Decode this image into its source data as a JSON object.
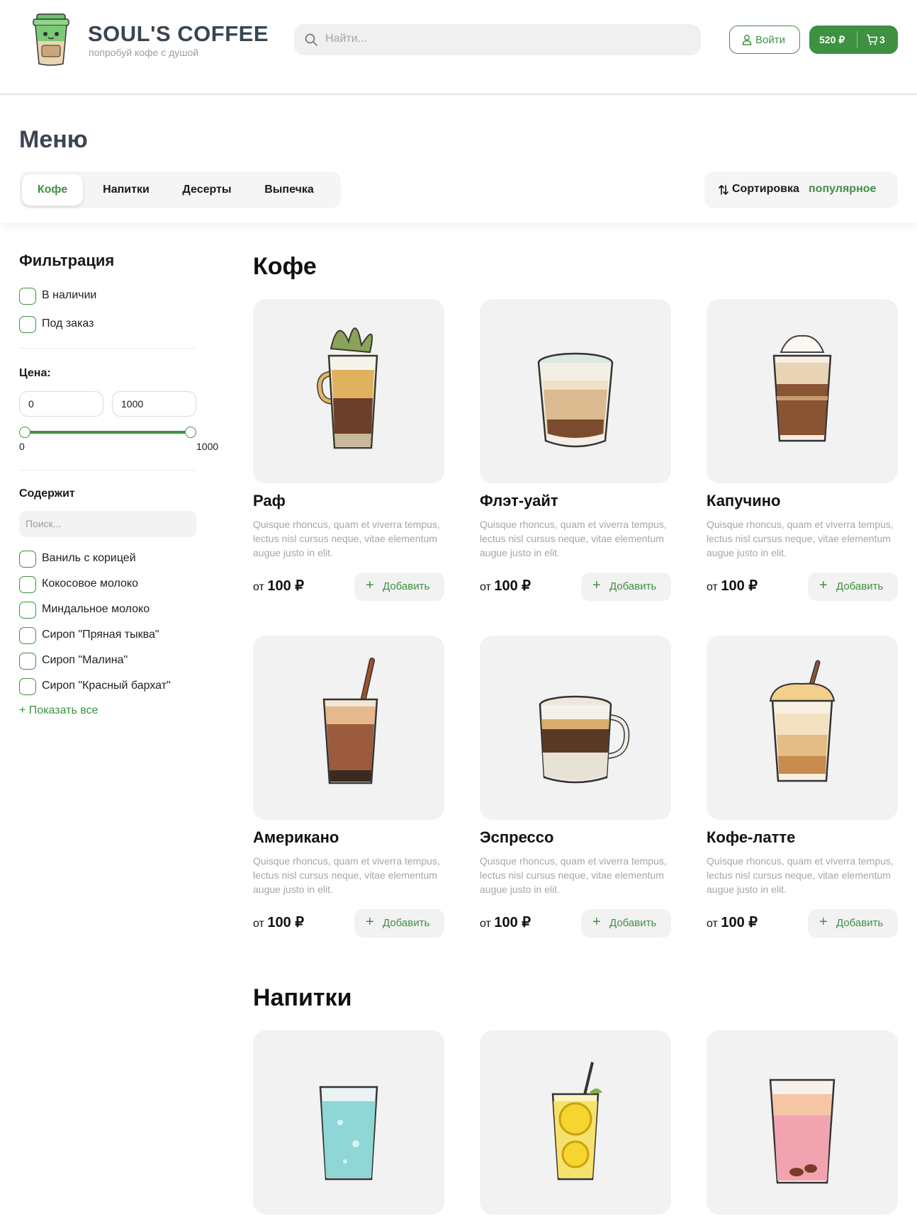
{
  "header": {
    "brand_name": "SOUL'S COFFEE",
    "brand_tagline": "попробуй кофе с душой",
    "search_placeholder": "Найти...",
    "login_label": "Войти",
    "cart_total": "520 ₽",
    "cart_count": "3"
  },
  "menu": {
    "title": "Меню",
    "tabs": [
      {
        "label": "Кофе",
        "active": true
      },
      {
        "label": "Напитки",
        "active": false
      },
      {
        "label": "Десерты",
        "active": false
      },
      {
        "label": "Выпечка",
        "active": false
      }
    ],
    "sort_label": "Сортировка",
    "sort_value": "популярное"
  },
  "filters": {
    "title": "Фильтрация",
    "availability": [
      {
        "label": "В наличии",
        "checked": false
      },
      {
        "label": "Под заказ",
        "checked": false
      }
    ],
    "price_title": "Цена:",
    "price_min": "0",
    "price_max": "1000",
    "slider_min_label": "0",
    "slider_max_label": "1000",
    "contains_title": "Содержит",
    "contains_search_placeholder": "Поиск...",
    "contains": [
      {
        "label": "Ваниль с корицей",
        "checked": false
      },
      {
        "label": "Кокосовое молоко",
        "checked": false
      },
      {
        "label": "Миндальное молоко",
        "checked": false
      },
      {
        "label": "Сироп \"Пряная тыква\"",
        "checked": false
      },
      {
        "label": "Сироп \"Малина\"",
        "checked": false
      },
      {
        "label": "Сироп \"Красный бархат\"",
        "checked": false
      }
    ],
    "show_all": "+ Показать все"
  },
  "sections": [
    {
      "title": "Кофе",
      "products": [
        {
          "name": "Раф",
          "description": "Quisque rhoncus, quam et viverra tempus, lectus nisl cursus neque, vitae elementum augue justo in elit.",
          "price_prefix": "от",
          "price": "100 ₽",
          "add_label": "Добавить",
          "image_icon": "raf-glass-icon"
        },
        {
          "name": "Флэт-уайт",
          "description": "Quisque rhoncus, quam et viverra tempus, lectus nisl cursus neque, vitae elementum augue justo in elit.",
          "price_prefix": "от",
          "price": "100 ₽",
          "add_label": "Добавить",
          "image_icon": "flat-white-glass-icon"
        },
        {
          "name": "Капучино",
          "description": "Quisque rhoncus, quam et viverra tempus, lectus nisl cursus neque, vitae elementum augue justo in elit.",
          "price_prefix": "от",
          "price": "100 ₽",
          "add_label": "Добавить",
          "image_icon": "cappuccino-glass-icon"
        },
        {
          "name": "Американо",
          "description": "Quisque rhoncus, quam et viverra tempus, lectus nisl cursus neque, vitae elementum augue justo in elit.",
          "price_prefix": "от",
          "price": "100 ₽",
          "add_label": "Добавить",
          "image_icon": "americano-glass-icon"
        },
        {
          "name": "Эспрессо",
          "description": "Quisque rhoncus, quam et viverra tempus, lectus nisl cursus neque, vitae elementum augue justo in elit.",
          "price_prefix": "от",
          "price": "100 ₽",
          "add_label": "Добавить",
          "image_icon": "espresso-mug-icon"
        },
        {
          "name": "Кофе-латте",
          "description": "Quisque rhoncus, quam et viverra tempus, lectus nisl cursus neque, vitae elementum augue justo in elit.",
          "price_prefix": "от",
          "price": "100 ₽",
          "add_label": "Добавить",
          "image_icon": "latte-glass-icon"
        }
      ]
    },
    {
      "title": "Напитки",
      "products": [
        {
          "image_icon": "water-glass-icon"
        },
        {
          "image_icon": "lemonade-glass-icon"
        },
        {
          "image_icon": "berry-tea-glass-icon"
        }
      ]
    }
  ],
  "colors": {
    "accent": "#3e9141",
    "heading": "#3a4552",
    "card_bg": "#f2f2f2",
    "muted_text": "#a6a6a6"
  }
}
